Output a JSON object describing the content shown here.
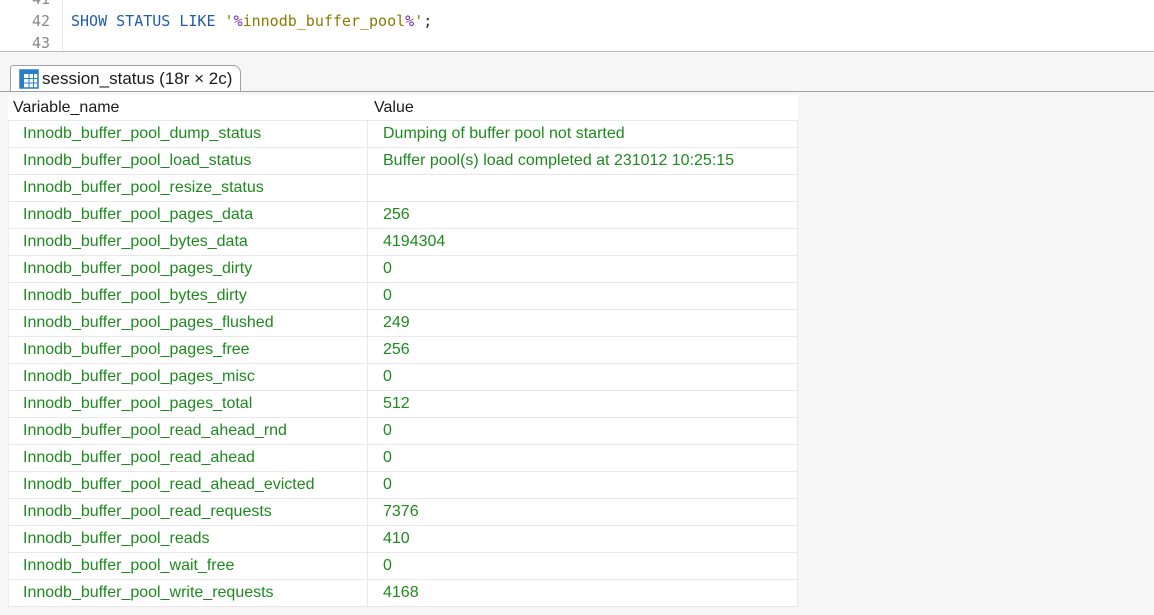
{
  "editor": {
    "lines": [
      {
        "num": "41",
        "tokens": []
      },
      {
        "num": "42",
        "tokens": [
          {
            "text": "SHOW STATUS LIKE ",
            "kind": "kw"
          },
          {
            "text": "'",
            "kind": "str"
          },
          {
            "text": "%",
            "kind": "pct"
          },
          {
            "text": "innodb_buffer_pool",
            "kind": "str"
          },
          {
            "text": "%",
            "kind": "pct"
          },
          {
            "text": "'",
            "kind": "str"
          },
          {
            "text": ";",
            "kind": "plain"
          }
        ]
      },
      {
        "num": "43",
        "tokens": []
      }
    ]
  },
  "result_tab": {
    "label": "session_status (18r × 2c)",
    "icon": "table-grid-icon"
  },
  "grid": {
    "columns": [
      "Variable_name",
      "Value"
    ],
    "rows": [
      [
        "Innodb_buffer_pool_dump_status",
        "Dumping of buffer pool not started"
      ],
      [
        "Innodb_buffer_pool_load_status",
        "Buffer pool(s) load completed at 231012 10:25:15"
      ],
      [
        "Innodb_buffer_pool_resize_status",
        ""
      ],
      [
        "Innodb_buffer_pool_pages_data",
        "256"
      ],
      [
        "Innodb_buffer_pool_bytes_data",
        "4194304"
      ],
      [
        "Innodb_buffer_pool_pages_dirty",
        "0"
      ],
      [
        "Innodb_buffer_pool_bytes_dirty",
        "0"
      ],
      [
        "Innodb_buffer_pool_pages_flushed",
        "249"
      ],
      [
        "Innodb_buffer_pool_pages_free",
        "256"
      ],
      [
        "Innodb_buffer_pool_pages_misc",
        "0"
      ],
      [
        "Innodb_buffer_pool_pages_total",
        "512"
      ],
      [
        "Innodb_buffer_pool_read_ahead_rnd",
        "0"
      ],
      [
        "Innodb_buffer_pool_read_ahead",
        "0"
      ],
      [
        "Innodb_buffer_pool_read_ahead_evicted",
        "0"
      ],
      [
        "Innodb_buffer_pool_read_requests",
        "7376"
      ],
      [
        "Innodb_buffer_pool_reads",
        "410"
      ],
      [
        "Innodb_buffer_pool_wait_free",
        "0"
      ],
      [
        "Innodb_buffer_pool_write_requests",
        "4168"
      ]
    ]
  },
  "colors": {
    "keyword": "#1f5fa8",
    "string": "#8a7a00",
    "wildcard": "#7a2aa8",
    "cell_text": "#1e8a1e"
  }
}
